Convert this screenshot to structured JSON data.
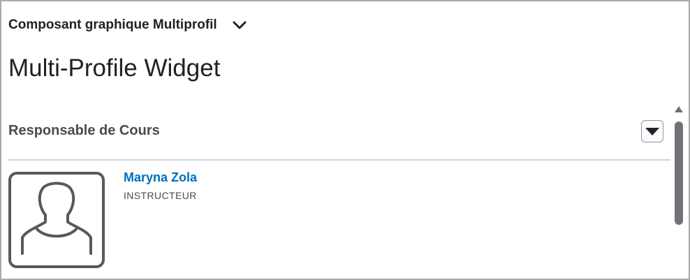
{
  "widget": {
    "header_label": "Composant graphique Multiprofil",
    "header_icon": "chevron-down-icon",
    "page_title": "Multi-Profile Widget"
  },
  "section": {
    "title": "Responsable de Cours",
    "toggle_icon": "caret-down-icon"
  },
  "profiles": [
    {
      "name": "Maryna Zola",
      "role": "INSTRUCTEUR",
      "avatar_icon": "user-silhouette-icon"
    }
  ],
  "colors": {
    "link": "#006fbf",
    "text": "#202122",
    "muted_text": "#494c4e",
    "divider": "#cdd5dc",
    "icon": "#565a5c",
    "border": "#a9a9a9"
  }
}
